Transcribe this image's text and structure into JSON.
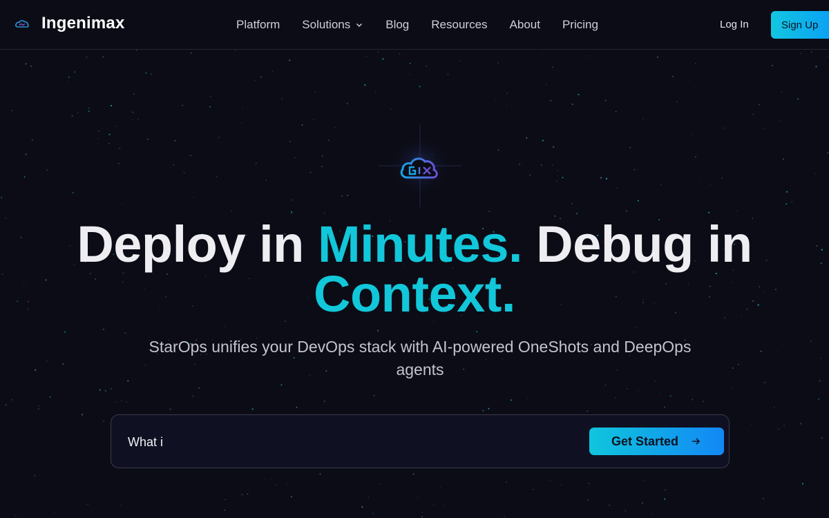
{
  "brand": {
    "name": "Ingenimax",
    "logo_icon": "cloud-logo-icon"
  },
  "nav": {
    "items": [
      {
        "label": "Platform"
      },
      {
        "label": "Solutions",
        "has_dropdown": true
      },
      {
        "label": "Blog"
      },
      {
        "label": "Resources"
      },
      {
        "label": "About"
      },
      {
        "label": "Pricing"
      }
    ],
    "login_label": "Log In",
    "signup_label": "Sign Up"
  },
  "hero": {
    "logo_icon": "gix-cloud-icon",
    "headline_part1": "Deploy in ",
    "headline_accent1": "Minutes.",
    "headline_part2": " Debug in",
    "headline_accent2": "Context.",
    "subtitle": "StarOps unifies your DevOps stack with AI-powered OneShots and DeepOps agents",
    "prompt_value": "What i",
    "cta_label": "Get Started"
  },
  "colors": {
    "background": "#0c0c16",
    "accent": "#12c7d9",
    "button_gradient_start": "#10c5dd",
    "button_gradient_end": "#1288f5"
  }
}
